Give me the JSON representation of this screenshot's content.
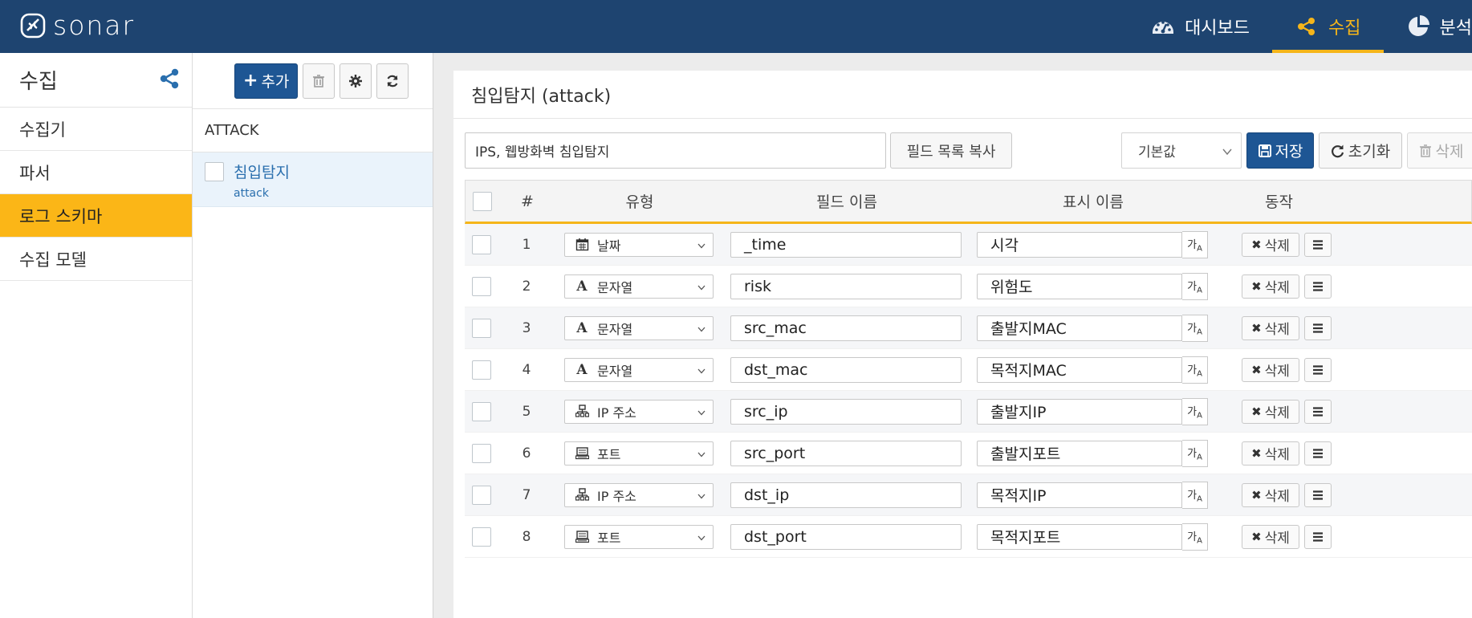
{
  "app": {
    "logo_text": "sonar"
  },
  "nav": [
    {
      "label": "대시보드",
      "icon": "dashboard-icon",
      "active": false
    },
    {
      "label": "수집",
      "icon": "share-icon",
      "active": true
    },
    {
      "label": "분석",
      "icon": "pie-chart-icon",
      "active": false
    }
  ],
  "sidebar": {
    "title": "수집",
    "items": [
      {
        "label": "수집기"
      },
      {
        "label": "파서"
      },
      {
        "label": "로그 스키마"
      },
      {
        "label": "수집 모델"
      }
    ]
  },
  "list_panel": {
    "add_label": "추가",
    "group": "ATTACK",
    "items": [
      {
        "title": "침입탐지",
        "sub": "attack"
      }
    ]
  },
  "detail": {
    "title": "침입탐지 (attack)",
    "description": "IPS, 웹방화벽 침입탐지",
    "copy_fields_label": "필드 목록 복사",
    "default_select": "기본값",
    "save_label": "저장",
    "reset_label": "초기화",
    "delete_label": "삭제"
  },
  "table": {
    "headers": {
      "num": "#",
      "type": "유형",
      "field": "필드 이름",
      "display": "표시 이름",
      "action": "동작"
    },
    "rows": [
      {
        "num": "1",
        "type": "날짜",
        "type_icon": "calendar-icon",
        "field": "_time",
        "display": "시각"
      },
      {
        "num": "2",
        "type": "문자열",
        "type_icon": "font-icon",
        "field": "risk",
        "display": "위험도"
      },
      {
        "num": "3",
        "type": "문자열",
        "type_icon": "font-icon",
        "field": "src_mac",
        "display": "출발지MAC"
      },
      {
        "num": "4",
        "type": "문자열",
        "type_icon": "font-icon",
        "field": "dst_mac",
        "display": "목적지MAC"
      },
      {
        "num": "5",
        "type": "IP 주소",
        "type_icon": "network-icon",
        "field": "src_ip",
        "display": "출발지IP"
      },
      {
        "num": "6",
        "type": "포트",
        "type_icon": "port-icon",
        "field": "src_port",
        "display": "출발지포트"
      },
      {
        "num": "7",
        "type": "IP 주소",
        "type_icon": "network-icon",
        "field": "dst_ip",
        "display": "목적지IP"
      },
      {
        "num": "8",
        "type": "포트",
        "type_icon": "port-icon",
        "field": "dst_port",
        "display": "목적지포트"
      }
    ],
    "row_delete_label": "삭제"
  },
  "colors": {
    "topbar": "#1e4470",
    "accent": "#f5b51a",
    "primary": "#1e5694",
    "selected_row": "#eaf3fb"
  }
}
